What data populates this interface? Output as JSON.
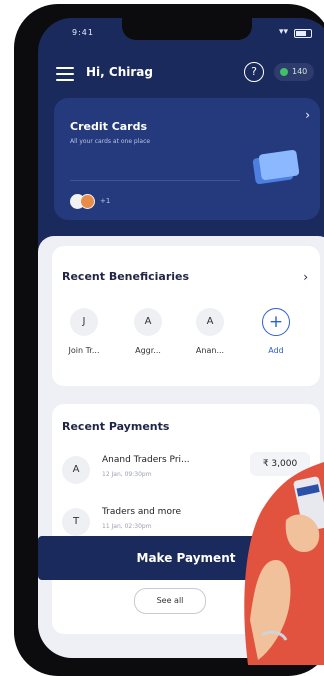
{
  "status_bar": {
    "time": "9:41",
    "signal": "▾▾"
  },
  "header": {
    "greeting": "Hi, Chirag",
    "help_icon": "?",
    "coins": "140"
  },
  "credit_cards": {
    "title": "Credit Cards",
    "subtitle": "All your cards at one place",
    "chevron": "›",
    "more_count": "+1"
  },
  "recent_beneficiaries": {
    "title": "Recent Beneficiaries",
    "chevron": "›",
    "items": [
      {
        "initial": "J",
        "label": "Join Tr..."
      },
      {
        "initial": "A",
        "label": "Aggr..."
      },
      {
        "initial": "A",
        "label": "Anan..."
      }
    ],
    "add_symbol": "+",
    "add_label": "Add"
  },
  "recent_payments": {
    "title": "Recent Payments",
    "items": [
      {
        "initial": "A",
        "name": "Anand Traders Pri...",
        "date": "12 Jan, 09:30pm",
        "amount": "₹ 3,000"
      },
      {
        "initial": "T",
        "name": "Traders and more",
        "date": "11 Jan, 02:30pm",
        "amount": ""
      }
    ],
    "make_payment_label": "Make Payment",
    "see_all_label": "See all"
  },
  "colors": {
    "primary_navy": "#1b2a5c",
    "card_blue": "#243a7c",
    "accent_blue": "#2d5fd6",
    "coin_green": "#41c06a"
  }
}
